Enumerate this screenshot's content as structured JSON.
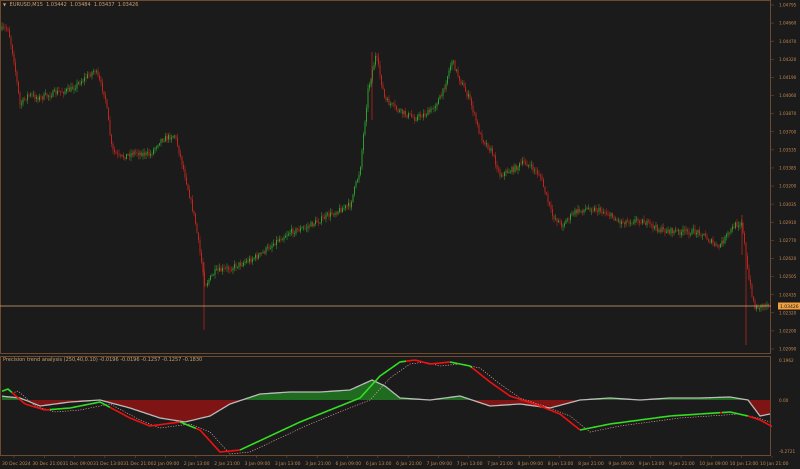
{
  "chart": {
    "symbol_line": {
      "symbol": "EURUSD,M15",
      "open": "1.03442",
      "high": "1.03484",
      "low": "1.03437",
      "close": "1.03426"
    },
    "price_axis": [
      "1.04795",
      "1.04660",
      "1.04470",
      "1.04320",
      "1.04190",
      "1.04060",
      "1.03870",
      "1.03700",
      "1.03535",
      "1.03385",
      "1.03200",
      "1.03035",
      "1.02910",
      "1.02770",
      "1.02620",
      "1.02505",
      "1.02435",
      "1.02320",
      "1.02200",
      "1.02090"
    ],
    "current_price": "1.03426",
    "time_axis": [
      "30 Dec 2024",
      "30 Dec 21:00",
      "31 Dec 09:00",
      "31 Dec 13:00",
      "31 Dec 21:00",
      "2 Jan 09:00",
      "2 Jan 13:00",
      "2 Jan 21:00",
      "3 Jan 09:00",
      "3 Jan 13:00",
      "3 Jan 21:00",
      "6 Jan 09:00",
      "6 Jan 13:00",
      "6 Jan 21:00",
      "7 Jan 09:00",
      "7 Jan 13:00",
      "7 Jan 21:00",
      "8 Jan 09:00",
      "8 Jan 13:00",
      "8 Jan 21:00",
      "9 Jan 09:00",
      "9 Jan 13:00",
      "9 Jan 21:00",
      "10 Jan 09:00",
      "10 Jan 13:00",
      "10 Jan 21:00"
    ],
    "colors": {
      "background": "#1b1b1b",
      "bull_candle": "#2fa82f",
      "bear_candle": "#c8271f",
      "axis_text": "#c08850",
      "frame": "#6e4b2f",
      "price_line": "#d9a772",
      "price_tag": "#f0a040"
    }
  },
  "indicator": {
    "title": "Precision trend analysis (250,40,0.10) -0.0196 -0.0196 -0.1257 -0.1257 -0.1830",
    "scale_top": "0.1962",
    "scale_zero": "0.00",
    "scale_bottom": "-0.2721",
    "colors": {
      "fast_up": "#33dd22",
      "fast_down": "#ee1111",
      "signal": "#bbbbbb",
      "hist_pos": "#1f6b1f",
      "hist_neg": "#7f1414",
      "dotted": "#ffb0b0"
    }
  }
}
